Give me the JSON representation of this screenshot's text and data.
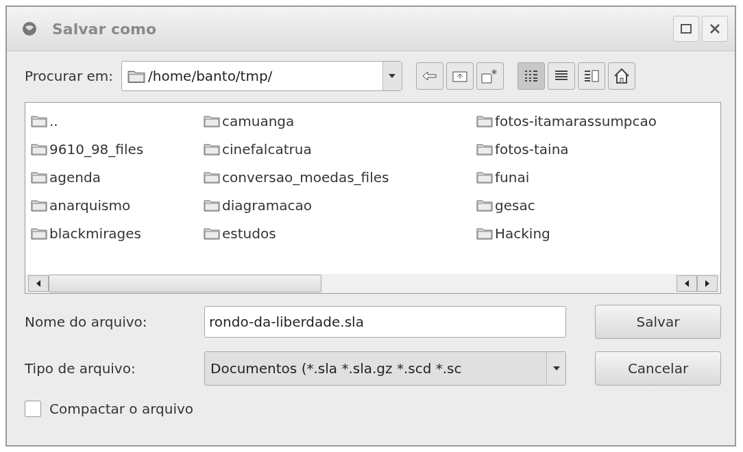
{
  "window": {
    "title": "Salvar como"
  },
  "look_in": {
    "label": "Procurar em:",
    "path": "/home/banto/tmp/"
  },
  "nav_buttons": [
    {
      "kind": "back"
    },
    {
      "kind": "up"
    },
    {
      "kind": "new-folder"
    }
  ],
  "view_buttons": [
    {
      "kind": "detail",
      "selected": true
    },
    {
      "kind": "list",
      "selected": false
    },
    {
      "kind": "preview",
      "selected": false
    },
    {
      "kind": "home",
      "selected": false
    }
  ],
  "files": [
    {
      "name": ".."
    },
    {
      "name": "9610_98_files"
    },
    {
      "name": "agenda"
    },
    {
      "name": "anarquismo"
    },
    {
      "name": "blackmirages"
    },
    {
      "name": "camuanga"
    },
    {
      "name": "cinefalcatrua"
    },
    {
      "name": "conversao_moedas_files"
    },
    {
      "name": "diagramacao"
    },
    {
      "name": "estudos"
    },
    {
      "name": "fotos-itamarassumpcao"
    },
    {
      "name": "fotos-taina"
    },
    {
      "name": "funai"
    },
    {
      "name": "gesac"
    },
    {
      "name": "Hacking"
    }
  ],
  "file_name": {
    "label": "Nome do arquivo:",
    "value": "rondo-da-liberdade.sla"
  },
  "file_type": {
    "label": "Tipo de arquivo:",
    "value": "Documentos (*.sla *.sla.gz *.scd *.sc"
  },
  "buttons": [
    {
      "label": "Salvar"
    },
    {
      "label": "Cancelar"
    }
  ],
  "compress": {
    "label": "Compactar o arquivo",
    "checked": false
  }
}
